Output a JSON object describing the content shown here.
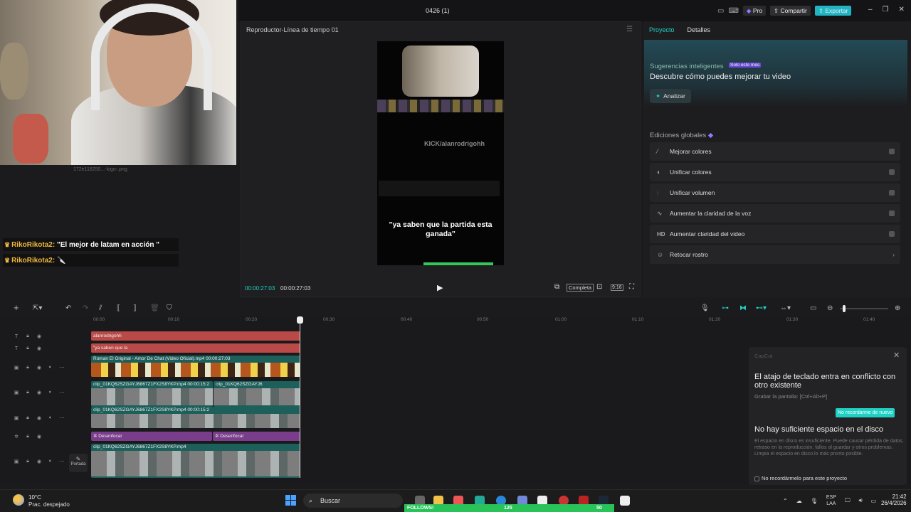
{
  "window": {
    "title": "0426 (1)",
    "pro_label": "Pro",
    "share_label": "Compartir",
    "export_label": "Exportar"
  },
  "media": {
    "file_label": "172e118250...-logo-.png"
  },
  "chat": [
    {
      "user": "RikoRikota2:",
      "message": "\"El mejor de latam en acción \""
    },
    {
      "user": "RikoRikota2:",
      "message": "🔪"
    }
  ],
  "player": {
    "title": "Reproductor-Línea de tiempo 01",
    "current_time": "00:00:27:03",
    "total_time": "00:00:27:03",
    "ratio_label": "Completa",
    "kick_text": "KICK/alanrodrigohh",
    "caption": "\"ya saben que la partida esta ganada\""
  },
  "right_panel": {
    "tabs": [
      "Proyecto",
      "Detalles"
    ],
    "suggestions_title": "Sugerencias inteligentes",
    "suggestions_badge": "Solo este mes",
    "suggestions_desc": "Descubre cómo puedes mejorar tu video",
    "analyze_label": "Analizar",
    "global_edits_title": "Ediciones globales",
    "items": [
      {
        "label": "Mejorar colores",
        "icon": "magic-wand-icon"
      },
      {
        "label": "Unificar colores",
        "icon": "color-match-icon"
      },
      {
        "label": "Unificar volumen",
        "icon": "equalizer-icon"
      },
      {
        "label": "Aumentar la claridad de la voz",
        "icon": "voice-wave-icon"
      },
      {
        "label": "Aumentar claridad del video",
        "icon": "hd-icon"
      },
      {
        "label": "Retocar rostro",
        "icon": "face-retouch-icon"
      }
    ]
  },
  "timeline": {
    "ruler": [
      "00:00",
      "00:10",
      "00:20",
      "00:30",
      "00:40",
      "00:50",
      "01:00",
      "01:10",
      "01:20",
      "01:30",
      "01:40"
    ],
    "text_clips": [
      "alanrodrigohh",
      "\"ya saben que la"
    ],
    "main_clip_label": "Roman El Original - Amor De Chat (Video Oficial).mp4   00:00:27:03",
    "clip_label_a": "clip_01KQ62SZGAYJ6867Z1FX2S8YKP.mp4   00:00:15:2",
    "clip_label_b": "clip_01KQ62SZGAYJ6",
    "clip_label_c": "clip_01KQ62SZGAYJ6867Z1FX2S8YKP.mp4",
    "effect_label": "Desenfocar",
    "cover_label": "Portada"
  },
  "notification": {
    "app": "CapCut",
    "n1_title": "El atajo de teclado entra en conflicto con otro existente",
    "n1_body": "Grabar la pantalla: [Ctrl+Alt+P]",
    "n1_button": "No recordarme de nuevo",
    "n2_title": "No hay suficiente espacio en el disco",
    "n2_body": "El espacio en disco es insuficiente. Puede causar pérdida de datos, retraso en la reproducción, fallos al guardar y otros problemas. Limpia el espacio en disco lo más pronto posible.",
    "n2_check": "No recordármelo para este proyecto"
  },
  "taskbar": {
    "temp": "10°C",
    "weather": "Prac. despejado",
    "search": "Buscar",
    "follows": "FOLLOWS!",
    "follow_count": "125",
    "follow_goal": "50",
    "lang": "ESP",
    "layout": "LAA",
    "time": "21:42",
    "date": "26/4/2026"
  },
  "colors": {
    "accent": "#1fd1c4",
    "text_clip": "#b94a47",
    "video_clip": "#1d5f5b",
    "effect_clip": "#7a3d8c"
  }
}
